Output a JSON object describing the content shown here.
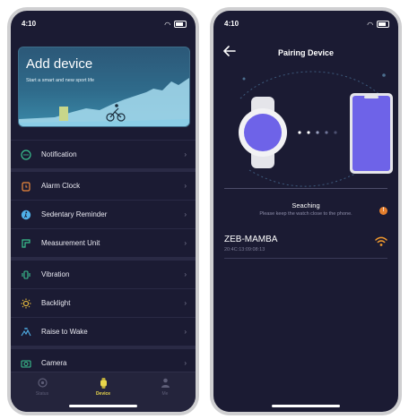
{
  "left_screen": {
    "status_time": "4:10",
    "add_device": {
      "title": "Add device",
      "subtitle": "Start a smart and new sport life"
    },
    "menu": [
      {
        "label": "Notification",
        "icon": "chat-bubble-icon",
        "color": "#3ac28f"
      },
      {
        "label": "Alarm Clock",
        "icon": "alarm-clock-icon",
        "color": "#f08a3c"
      },
      {
        "label": "Sedentary Reminder",
        "icon": "person-walk-icon",
        "color": "#4fb0e8"
      },
      {
        "label": "Measurement Unit",
        "icon": "ruler-icon",
        "color": "#3ac28f"
      },
      {
        "label": "Vibration",
        "icon": "vibration-icon",
        "color": "#3ac28f"
      },
      {
        "label": "Backlight",
        "icon": "sun-icon",
        "color": "#f0c23c"
      },
      {
        "label": "Raise to Wake",
        "icon": "raise-hand-icon",
        "color": "#4fb0e8"
      },
      {
        "label": "Camera",
        "icon": "camera-icon",
        "color": "#3ac28f"
      }
    ],
    "tabs": [
      {
        "label": "Status",
        "icon": "status-icon"
      },
      {
        "label": "Device",
        "icon": "watch-icon"
      },
      {
        "label": "Me",
        "icon": "person-icon"
      }
    ],
    "colors": {
      "background": "#1b1b33",
      "active_tab": "#e9d64b"
    }
  },
  "right_screen": {
    "status_time": "4:10",
    "nav_title": "Pairing Device",
    "status_title": "Seaching",
    "status_hint": "Please keep the watch close to the phone.",
    "device": {
      "name": "ZEB-MAMBA",
      "mac": "20:4C:13:09:08:13"
    },
    "colors": {
      "watch_face": "#6e63e8",
      "phone_screen": "#6e63e8",
      "signal": "#f29a2e"
    }
  }
}
